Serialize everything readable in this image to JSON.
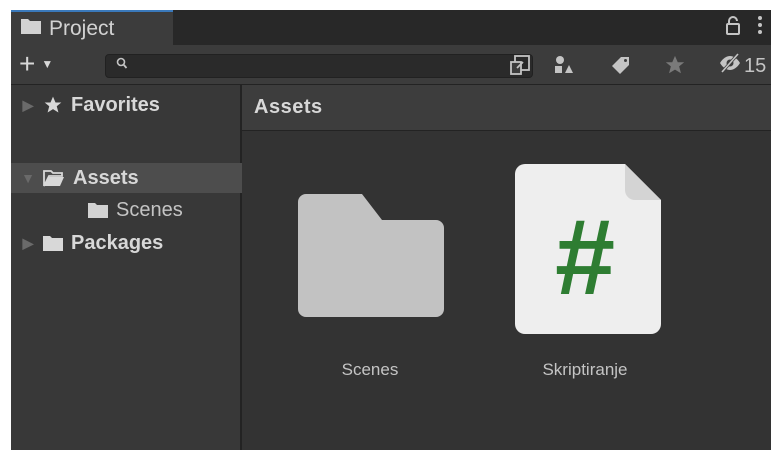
{
  "tab": {
    "title": "Project",
    "icon": "folder-icon"
  },
  "tabbar_right": {
    "lock_icon": "lock-icon",
    "menu_icon": "kebab-menu-icon"
  },
  "toolbar": {
    "add_label": "+",
    "search": {
      "value": "",
      "placeholder": ""
    },
    "icons": [
      "search-by-type-icon",
      "filter-by-type-icon",
      "filter-by-label-icon",
      "favorite-star-icon",
      "hidden-packages-icon"
    ],
    "hidden_packages_count": "15"
  },
  "sidebar": {
    "items": [
      {
        "label": "Favorites",
        "icon": "star-icon",
        "expanded": false
      },
      {
        "label": "Assets",
        "icon": "folder-open-icon",
        "expanded": true,
        "selected": true
      },
      {
        "label": "Scenes",
        "icon": "folder-icon"
      },
      {
        "label": "Packages",
        "icon": "folder-icon",
        "expanded": false
      }
    ]
  },
  "main": {
    "breadcrumb": "Assets",
    "assets": [
      {
        "label": "Scenes",
        "icon": "folder-icon"
      },
      {
        "label": "Skriptiranje",
        "icon": "csharp-script-icon",
        "glyph": "#"
      }
    ]
  },
  "colors": {
    "panel": "#3c3c3c",
    "tab_accent": "#3a79bb",
    "selection": "#4d4d4d",
    "script_green": "#2e7d32"
  }
}
